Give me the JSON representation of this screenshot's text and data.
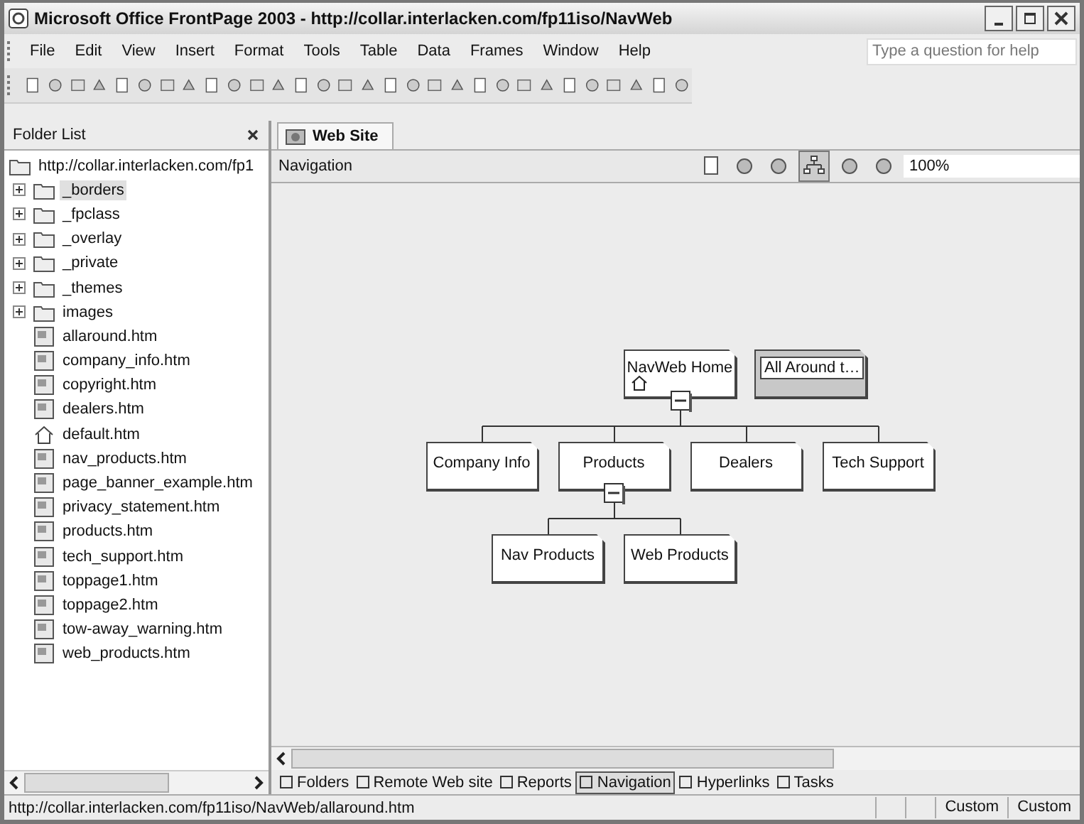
{
  "window": {
    "title": "Microsoft Office FrontPage 2003 - http://collar.interlacken.com/fp11iso/NavWeb"
  },
  "menu": [
    "File",
    "Edit",
    "View",
    "Insert",
    "Format",
    "Tools",
    "Table",
    "Data",
    "Frames",
    "Window",
    "Help"
  ],
  "help_box": {
    "placeholder": "Type a question for help"
  },
  "folder_list": {
    "title": "Folder List",
    "root": "http://collar.interlacken.com/fp1",
    "items": [
      {
        "name": "_borders",
        "kind": "folder",
        "selected": true
      },
      {
        "name": "_fpclass",
        "kind": "folder",
        "selected": false
      },
      {
        "name": "_overlay",
        "kind": "folder",
        "selected": false
      },
      {
        "name": "_private",
        "kind": "folder",
        "selected": false
      },
      {
        "name": "_themes",
        "kind": "folder",
        "selected": false
      },
      {
        "name": "images",
        "kind": "folder",
        "selected": false
      },
      {
        "name": "allaround.htm",
        "kind": "page",
        "selected": false
      },
      {
        "name": "company_info.htm",
        "kind": "page",
        "selected": false
      },
      {
        "name": "copyright.htm",
        "kind": "page",
        "selected": false
      },
      {
        "name": "dealers.htm",
        "kind": "page",
        "selected": false
      },
      {
        "name": "default.htm",
        "kind": "home",
        "selected": false
      },
      {
        "name": "nav_products.htm",
        "kind": "page",
        "selected": false
      },
      {
        "name": "page_banner_example.htm",
        "kind": "page",
        "selected": false
      },
      {
        "name": "privacy_statement.htm",
        "kind": "page",
        "selected": false
      },
      {
        "name": "products.htm",
        "kind": "page",
        "selected": false
      },
      {
        "name": "tech_support.htm",
        "kind": "page",
        "selected": false
      },
      {
        "name": "toppage1.htm",
        "kind": "page",
        "selected": false
      },
      {
        "name": "toppage2.htm",
        "kind": "page",
        "selected": false
      },
      {
        "name": "tow-away_warning.htm",
        "kind": "page",
        "selected": false
      },
      {
        "name": "web_products.htm",
        "kind": "page",
        "selected": false
      }
    ]
  },
  "document_tab": {
    "label": "Web Site"
  },
  "view_bar": {
    "title": "Navigation",
    "zoom": "100%"
  },
  "navigation": {
    "nodes": [
      {
        "label": "NavWeb Home",
        "kind": "home",
        "expanded": true,
        "children": [
          {
            "label": "Company Info",
            "kind": "page"
          },
          {
            "label": "Products",
            "kind": "page",
            "expanded": true,
            "children": [
              {
                "label": "Nav Products",
                "kind": "page"
              },
              {
                "label": "Web Products",
                "kind": "page"
              }
            ]
          },
          {
            "label": "Dealers",
            "kind": "page"
          },
          {
            "label": "Tech Support",
            "kind": "page"
          }
        ]
      },
      {
        "label": "All Around t…",
        "kind": "link-bar"
      }
    ]
  },
  "view_tabs": [
    {
      "label": "Folders",
      "selected": false
    },
    {
      "label": "Remote Web site",
      "selected": false
    },
    {
      "label": "Reports",
      "selected": false
    },
    {
      "label": "Navigation",
      "selected": true
    },
    {
      "label": "Hyperlinks",
      "selected": false
    },
    {
      "label": "Tasks",
      "selected": false
    }
  ],
  "status_bar": {
    "path": "http://collar.interlacken.com/fp11iso/NavWeb/allaround.htm",
    "cells": [
      "Custom",
      "Custom"
    ]
  }
}
